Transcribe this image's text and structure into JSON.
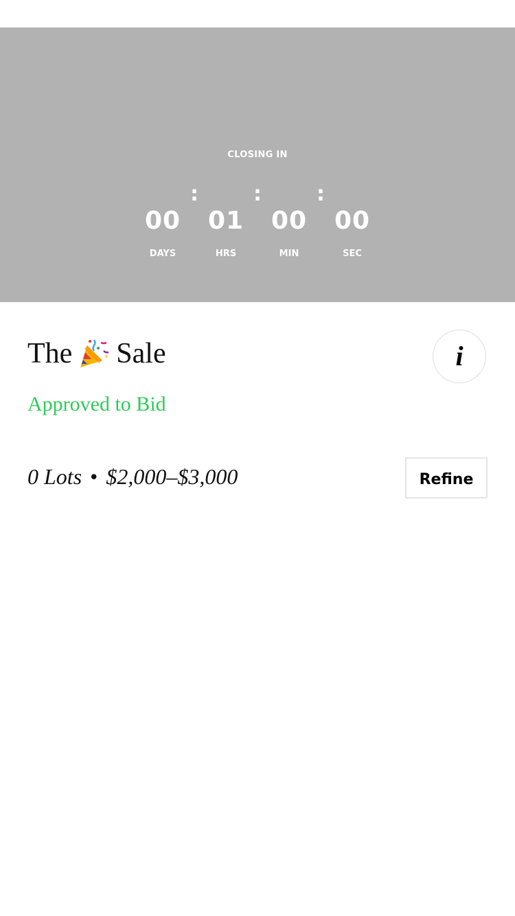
{
  "countdown": {
    "label": "CLOSING IN",
    "separator": ":",
    "units": [
      {
        "value": "00",
        "label": "DAYS"
      },
      {
        "value": "01",
        "label": "HRS"
      },
      {
        "value": "00",
        "label": "MIN"
      },
      {
        "value": "00",
        "label": "SEC"
      }
    ]
  },
  "sale": {
    "title_before": "The",
    "title_icon": "party-popper-icon",
    "title_after": "Sale",
    "status": "Approved to Bid",
    "info_icon_glyph": "i"
  },
  "lots": {
    "count_text": "0 Lots",
    "separator": "•",
    "range": "$2,000–$3,000",
    "refine_label": "Refine"
  },
  "colors": {
    "hero_background": "#b2b2b2",
    "approved_green": "#2ecc57"
  }
}
